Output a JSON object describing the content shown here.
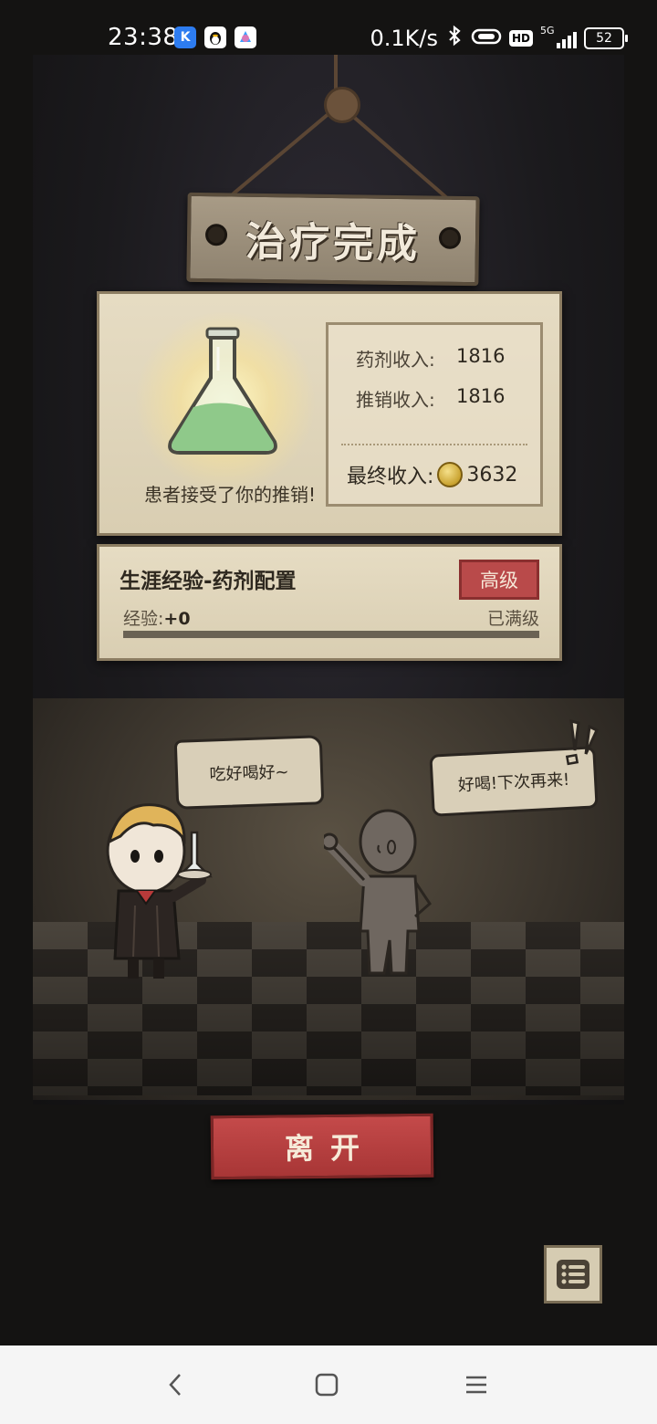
{
  "status_bar": {
    "time": "23:38",
    "network_speed": "0.1K/s",
    "hd_label": "HD",
    "signal_label": "5G",
    "battery": "52",
    "app_icons": [
      "k-app-icon",
      "qq-penguin-icon",
      "pinwheel-app-icon"
    ]
  },
  "title": "治疗完成",
  "reward": {
    "patient_message": "患者接受了你的推销!",
    "potion_income_label": "药剂收入:",
    "potion_income_value": "1816",
    "sales_income_label": "推销收入:",
    "sales_income_value": "1816",
    "final_income_label": "最终收入:",
    "final_income_value": "3632"
  },
  "experience": {
    "title": "生涯经验-药剂配置",
    "rank": "高级",
    "exp_label": "经验:",
    "exp_value": "+0",
    "status": "已满级",
    "progress": 1.0
  },
  "dialogue": {
    "doctor": "吃好喝好~",
    "patient": "好喝!下次再来!"
  },
  "buttons": {
    "leave": "离开"
  },
  "colors": {
    "parchment": "#e6dcc3",
    "accent_red": "#b94a4a",
    "potion_green": "#8fc98a"
  }
}
